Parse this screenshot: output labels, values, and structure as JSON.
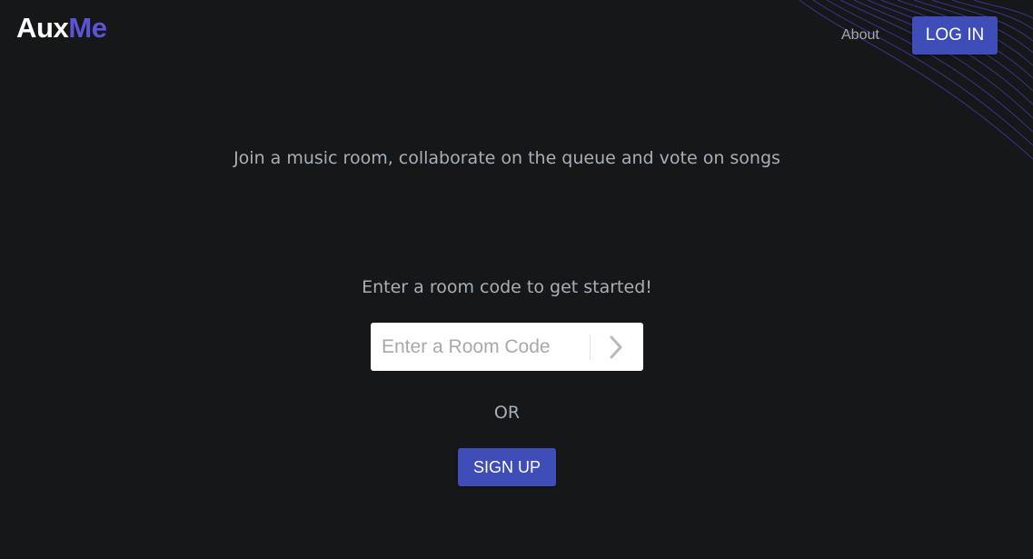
{
  "header": {
    "logo": {
      "part1": "Aux",
      "part2": "Me"
    },
    "nav": {
      "about_label": "About"
    },
    "login_label": "LOG IN"
  },
  "main": {
    "tagline": "Join a music room, collaborate on the queue and vote on songs",
    "prompt": "Enter a room code to get started!",
    "room_code": {
      "placeholder": "Enter a Room Code",
      "value": ""
    },
    "go_icon": "chevron-right-icon",
    "or_text": "OR",
    "signup_label": "SIGN UP"
  },
  "colors": {
    "background": "#161719",
    "accent": "#3f4db8",
    "logo_accent": "#5b55d6",
    "text_muted": "#a7afb7",
    "wave": "#3a338c"
  }
}
